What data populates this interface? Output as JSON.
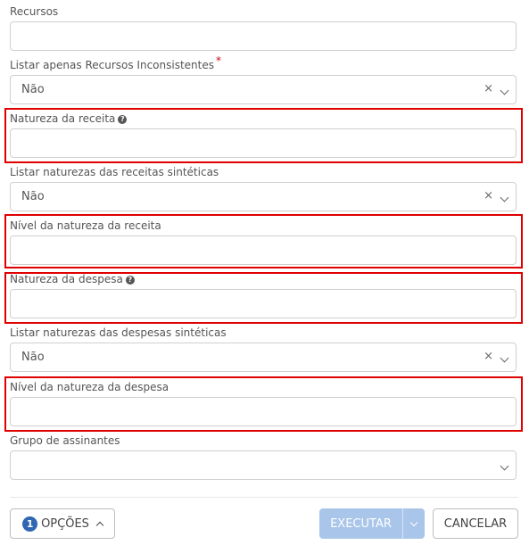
{
  "fields": {
    "recursos": {
      "label": "Recursos"
    },
    "listar_inconsistentes": {
      "label": "Listar apenas Recursos Inconsistentes",
      "required_mark": "*",
      "value": "Não",
      "clear_glyph": "×"
    },
    "natureza_receita": {
      "label": "Natureza da receita",
      "help_glyph": "?"
    },
    "listar_receitas_sinteticas": {
      "label": "Listar naturezas das receitas sintéticas",
      "value": "Não",
      "clear_glyph": "×"
    },
    "nivel_receita": {
      "label": "Nível da natureza da receita"
    },
    "natureza_despesa": {
      "label": "Natureza da despesa",
      "help_glyph": "?"
    },
    "listar_despesas_sinteticas": {
      "label": "Listar naturezas das despesas sintéticas",
      "value": "Não",
      "clear_glyph": "×"
    },
    "nivel_despesa": {
      "label": "Nível da natureza da despesa"
    },
    "grupo_assinantes": {
      "label": "Grupo de assinantes",
      "value": ""
    }
  },
  "footer": {
    "options_count": "1",
    "options_label": "OPÇÕES",
    "execute_label": "EXECUTAR",
    "cancel_label": "CANCELAR"
  },
  "colors": {
    "highlight": "#e00000",
    "primary_disabled": "#a9c6ea",
    "badge": "#2f67b2"
  }
}
